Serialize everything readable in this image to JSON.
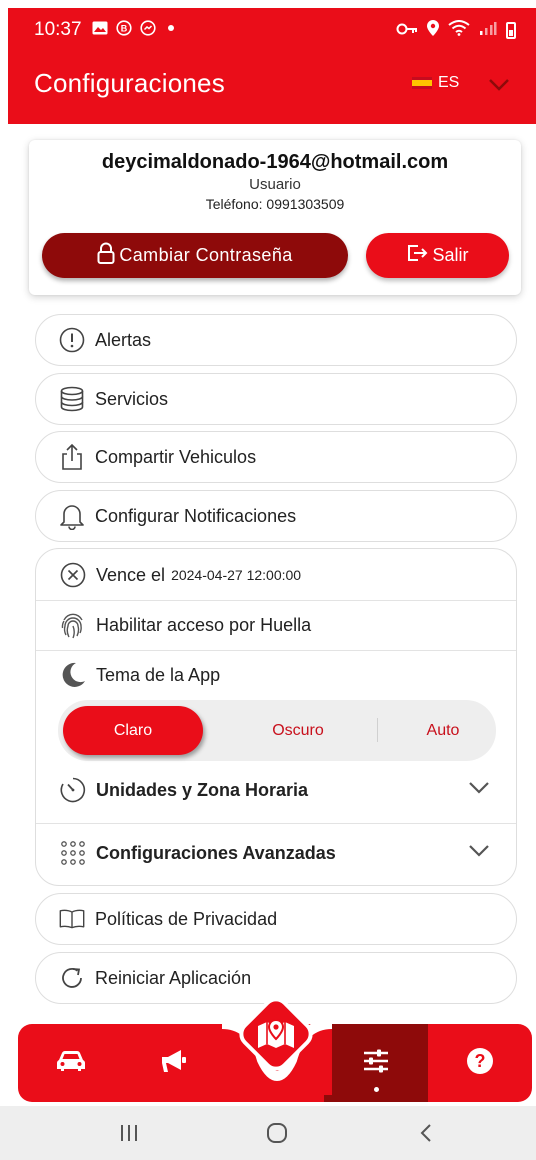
{
  "status_bar": {
    "time": "10:37"
  },
  "header": {
    "title": "Configuraciones",
    "language": "ES"
  },
  "account": {
    "email": "deycimaldonado-1964@hotmail.com",
    "role": "Usuario",
    "phone_label": "Teléfono:",
    "phone": "0991303509",
    "change_password_label": "Cambiar Contraseña",
    "logout_label": "Salir"
  },
  "menu": {
    "alerts": "Alertas",
    "services": "Servicios",
    "share": "Compartir Vehiculos",
    "notifications": "Configurar Notificaciones",
    "privacy": "Políticas de Privacidad",
    "restart": "Reiniciar Aplicación"
  },
  "settings": {
    "expiry_label": "Vence el",
    "expiry_value": "2024-04-27 12:00:00",
    "fingerprint_label": "Habilitar acceso por Huella",
    "theme_label": "Tema de la App",
    "theme_options": [
      "Claro",
      "Oscuro",
      "Auto"
    ],
    "theme_selected": "Claro",
    "units_label": "Unidades y Zona Horaria",
    "advanced_label": "Configuraciones Avanzadas"
  },
  "bottom_nav": {
    "items": [
      "car-icon",
      "megaphone-icon",
      "map-icon",
      "sliders-icon",
      "help-icon"
    ],
    "active": "sliders-icon"
  },
  "colors": {
    "primary": "#ea0d19",
    "primary_dark": "#8e0a0a",
    "border": "#dedede"
  }
}
